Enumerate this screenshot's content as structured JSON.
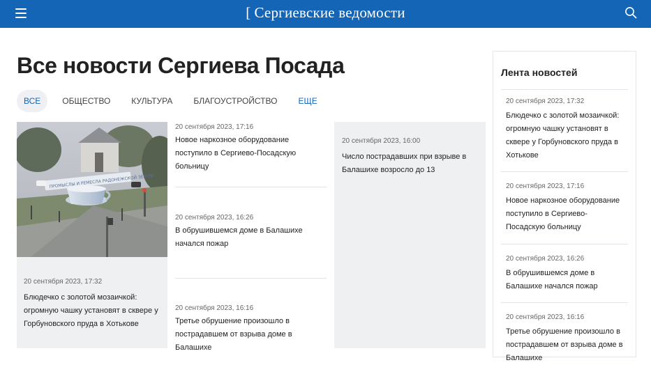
{
  "header": {
    "logo_bracket": "[",
    "logo_text": "Сергиевские ведомости",
    "brand_color": "#1565b6",
    "menu_icon": "hamburger-menu-icon",
    "search_icon": "search-icon"
  },
  "page": {
    "title": "Все новости Сергиева Посада"
  },
  "tabs": [
    {
      "label": "ВСЕ",
      "active": true
    },
    {
      "label": "ОБЩЕСТВО"
    },
    {
      "label": "КУЛЬТУРА"
    },
    {
      "label": "БЛАГОУСТРОЙСТВО"
    },
    {
      "label": "ЕЩЕ"
    }
  ],
  "featured": {
    "image_caption": "ПРОМЫСЛЫ И РЕМЕСЛА РАДОНЕЖСКОЙ ЗЕМЛИ",
    "date": "20 сентября 2023, 17:32",
    "title": "Блюдечко с золотой мозаичкой: огромную чашку установят в сквере у Горбуновского пруда в Хотькове"
  },
  "column_news": [
    {
      "date": "20 сентября 2023, 17:16",
      "title": "Новое наркозное оборудование поступило в Сергиево-Посадскую больницу"
    },
    {
      "date": "20 сентября 2023, 16:26",
      "title": "В обрушившемся доме в Балашихе начался пожар"
    },
    {
      "date": "20 сентября 2023, 16:16",
      "title": "Третье обрушение произошло в пострадавшем от взрыва доме в Балашихе"
    }
  ],
  "highlight": {
    "date": "20 сентября 2023, 16:00",
    "title": "Число пострадавших при взрыве в Балашихе возросло до 13"
  },
  "sidebar": {
    "title": "Лента новостей",
    "items": [
      {
        "date": "20 сентября 2023, 17:32",
        "title": "Блюдечко с золотой мозаичкой: огромную чашку установят в сквере у Горбуновского пруда в Хотькове"
      },
      {
        "date": "20 сентября 2023, 17:16",
        "title": "Новое наркозное оборудование поступило в Сергиево-Посадскую больницу"
      },
      {
        "date": "20 сентября 2023, 16:26",
        "title": "В обрушившемся доме в Балашихе начался пожар"
      },
      {
        "date": "20 сентября 2023, 16:16",
        "title": "Третье обрушение произошло в пострадавшем от взрыва доме в Балашихе"
      }
    ]
  }
}
